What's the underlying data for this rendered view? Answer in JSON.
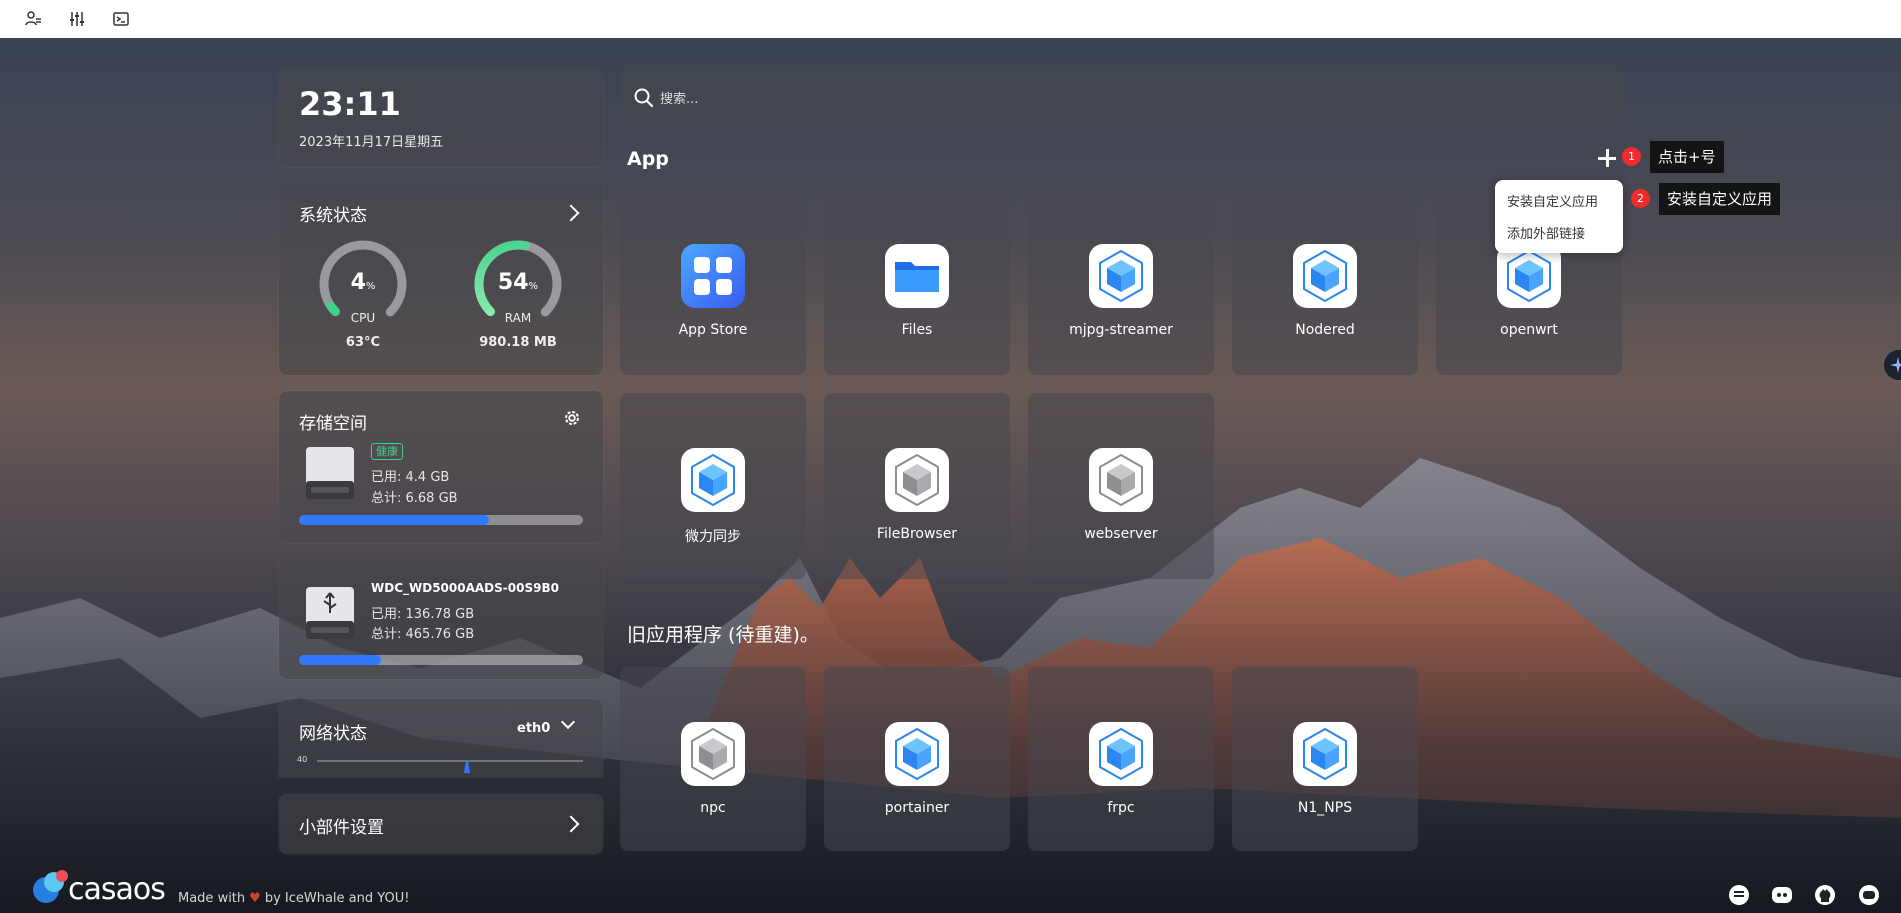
{
  "toolbar": {
    "icons": [
      "user-settings-icon",
      "sliders-icon",
      "terminal-icon"
    ]
  },
  "clock": {
    "time": "23:11",
    "date": "2023年11月17日星期五"
  },
  "system": {
    "title": "系统状态",
    "cpu": {
      "value": "4",
      "unit": "%",
      "label": "CPU",
      "extra": "63°C",
      "percent": 4
    },
    "ram": {
      "value": "54",
      "unit": "%",
      "label": "RAM",
      "extra": "980.18 MB",
      "percent": 54
    }
  },
  "storage": {
    "title": "存储空间",
    "disks": [
      {
        "badge": "健康",
        "used": "已用: 4.4 GB",
        "total": "总计: 6.68 GB",
        "fill": 0.67
      },
      {
        "name": "WDC_WD5000AADS-00S9B0",
        "used": "已用: 136.78 GB",
        "total": "总计: 465.76 GB",
        "fill": 0.29
      }
    ]
  },
  "network": {
    "title": "网络状态",
    "iface": "eth0",
    "axis_max": "40"
  },
  "widgets": {
    "title": "小部件设置"
  },
  "search": {
    "placeholder": "搜索..."
  },
  "apps": {
    "title": "App",
    "items": [
      {
        "name": "App Store",
        "icon": "app-store-icon"
      },
      {
        "name": "Files",
        "icon": "folder-icon"
      },
      {
        "name": "mjpg-streamer",
        "icon": "cube-icon"
      },
      {
        "name": "Nodered",
        "icon": "cube-icon"
      },
      {
        "name": "openwrt",
        "icon": "cube-icon"
      },
      {
        "name": "微力同步",
        "icon": "cube-icon"
      },
      {
        "name": "FileBrowser",
        "icon": "cube-gray-icon"
      },
      {
        "name": "webserver",
        "icon": "cube-gray-icon"
      }
    ]
  },
  "legacy": {
    "title": "旧应用程序 (待重建)。",
    "items": [
      {
        "name": "npc",
        "icon": "cube-gray-icon"
      },
      {
        "name": "portainer",
        "icon": "cube-icon"
      },
      {
        "name": "frpc",
        "icon": "cube-icon"
      },
      {
        "name": "N1_NPS",
        "icon": "cube-icon"
      }
    ]
  },
  "add_menu": {
    "item1": "安装自定义应用",
    "item2": "添加外部链接"
  },
  "annotations": {
    "step1": {
      "num": "1",
      "text": "点击+号"
    },
    "step2": {
      "num": "2",
      "text": "安装自定义应用"
    }
  },
  "footer": {
    "logo": "casaos",
    "made_with": "Made with",
    "by": "by IceWhale and YOU!"
  },
  "colors": {
    "accent": "#2f79ff",
    "ok": "#3fd08a",
    "annotation": "#ef2b2b"
  }
}
